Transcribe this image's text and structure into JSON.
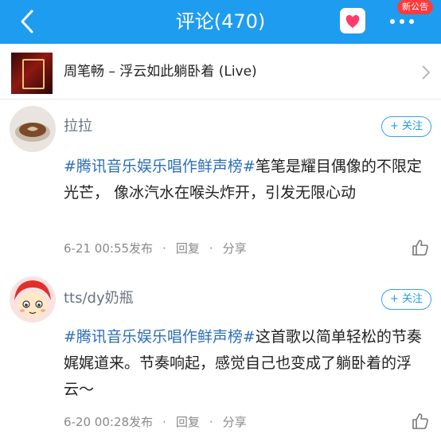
{
  "header": {
    "title": "评论(470)",
    "badge": "新公告"
  },
  "song": {
    "title": "周笔畅 – 浮云如此躺卧着 (Live)"
  },
  "comments": [
    {
      "user": "拉拉",
      "follow_label": "+ 关注",
      "hashtag": "#腾讯音乐娱乐唱作鲜声榜#",
      "text": "笔笔是耀目偶像的不限定光芒， 像冰汽水在喉头炸开，引发无限心动",
      "time": "6-21 00:55发布",
      "reply_label": "回复",
      "share_label": "分享"
    },
    {
      "user": "tts/dy奶瓶",
      "follow_label": "+ 关注",
      "hashtag": "#腾讯音乐娱乐唱作鲜声榜#",
      "text": "这首歌以简单轻松的节奏娓娓道来。节奏响起，感觉自己也变成了躺卧着的浮云～",
      "time": "6-20 00:28发布",
      "reply_label": "回复",
      "share_label": "分享"
    }
  ],
  "separator": "·",
  "icons": {
    "back": "chevron-left-icon",
    "favorite": "heart-icon",
    "more": "more-dots-icon",
    "song_chevron": "chevron-right-icon",
    "like": "thumbs-up-icon"
  },
  "colors": {
    "header_bg": "#1e9cf0",
    "hashtag": "#2d6fb7",
    "heart": "#ff3b6b",
    "badge": "#ff3b3b"
  }
}
